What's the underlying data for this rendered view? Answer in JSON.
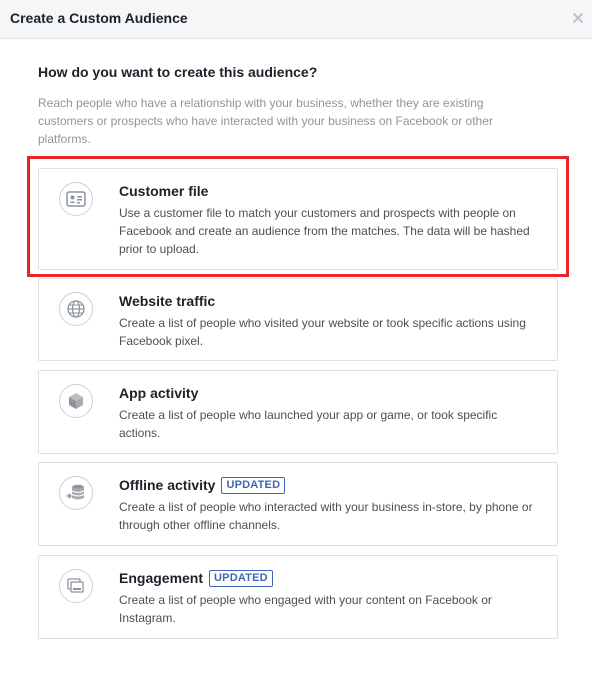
{
  "dialog": {
    "title": "Create a Custom Audience"
  },
  "content": {
    "question": "How do you want to create this audience?",
    "intro": "Reach people who have a relationship with your business, whether they are existing customers or prospects who have interacted with your business on Facebook or other platforms."
  },
  "options": [
    {
      "title": "Customer file",
      "badge": "",
      "description": "Use a customer file to match your customers and prospects with people on Facebook and create an audience from the matches. The data will be hashed prior to upload.",
      "icon": "contact-card-icon"
    },
    {
      "title": "Website traffic",
      "badge": "",
      "description": "Create a list of people who visited your website or took specific actions using Facebook pixel.",
      "icon": "globe-icon"
    },
    {
      "title": "App activity",
      "badge": "",
      "description": "Create a list of people who launched your app or game, or took specific actions.",
      "icon": "cube-icon"
    },
    {
      "title": "Offline activity",
      "badge": "UPDATED",
      "description": "Create a list of people who interacted with your business in-store, by phone or through other offline channels.",
      "icon": "offline-database-icon"
    },
    {
      "title": "Engagement",
      "badge": "UPDATED",
      "description": "Create a list of people who engaged with your content on Facebook or Instagram.",
      "icon": "engagement-cards-icon"
    }
  ],
  "colors": {
    "highlight": "#e8252a",
    "badge": "#4267b2",
    "header_bg": "#f5f6f7"
  }
}
